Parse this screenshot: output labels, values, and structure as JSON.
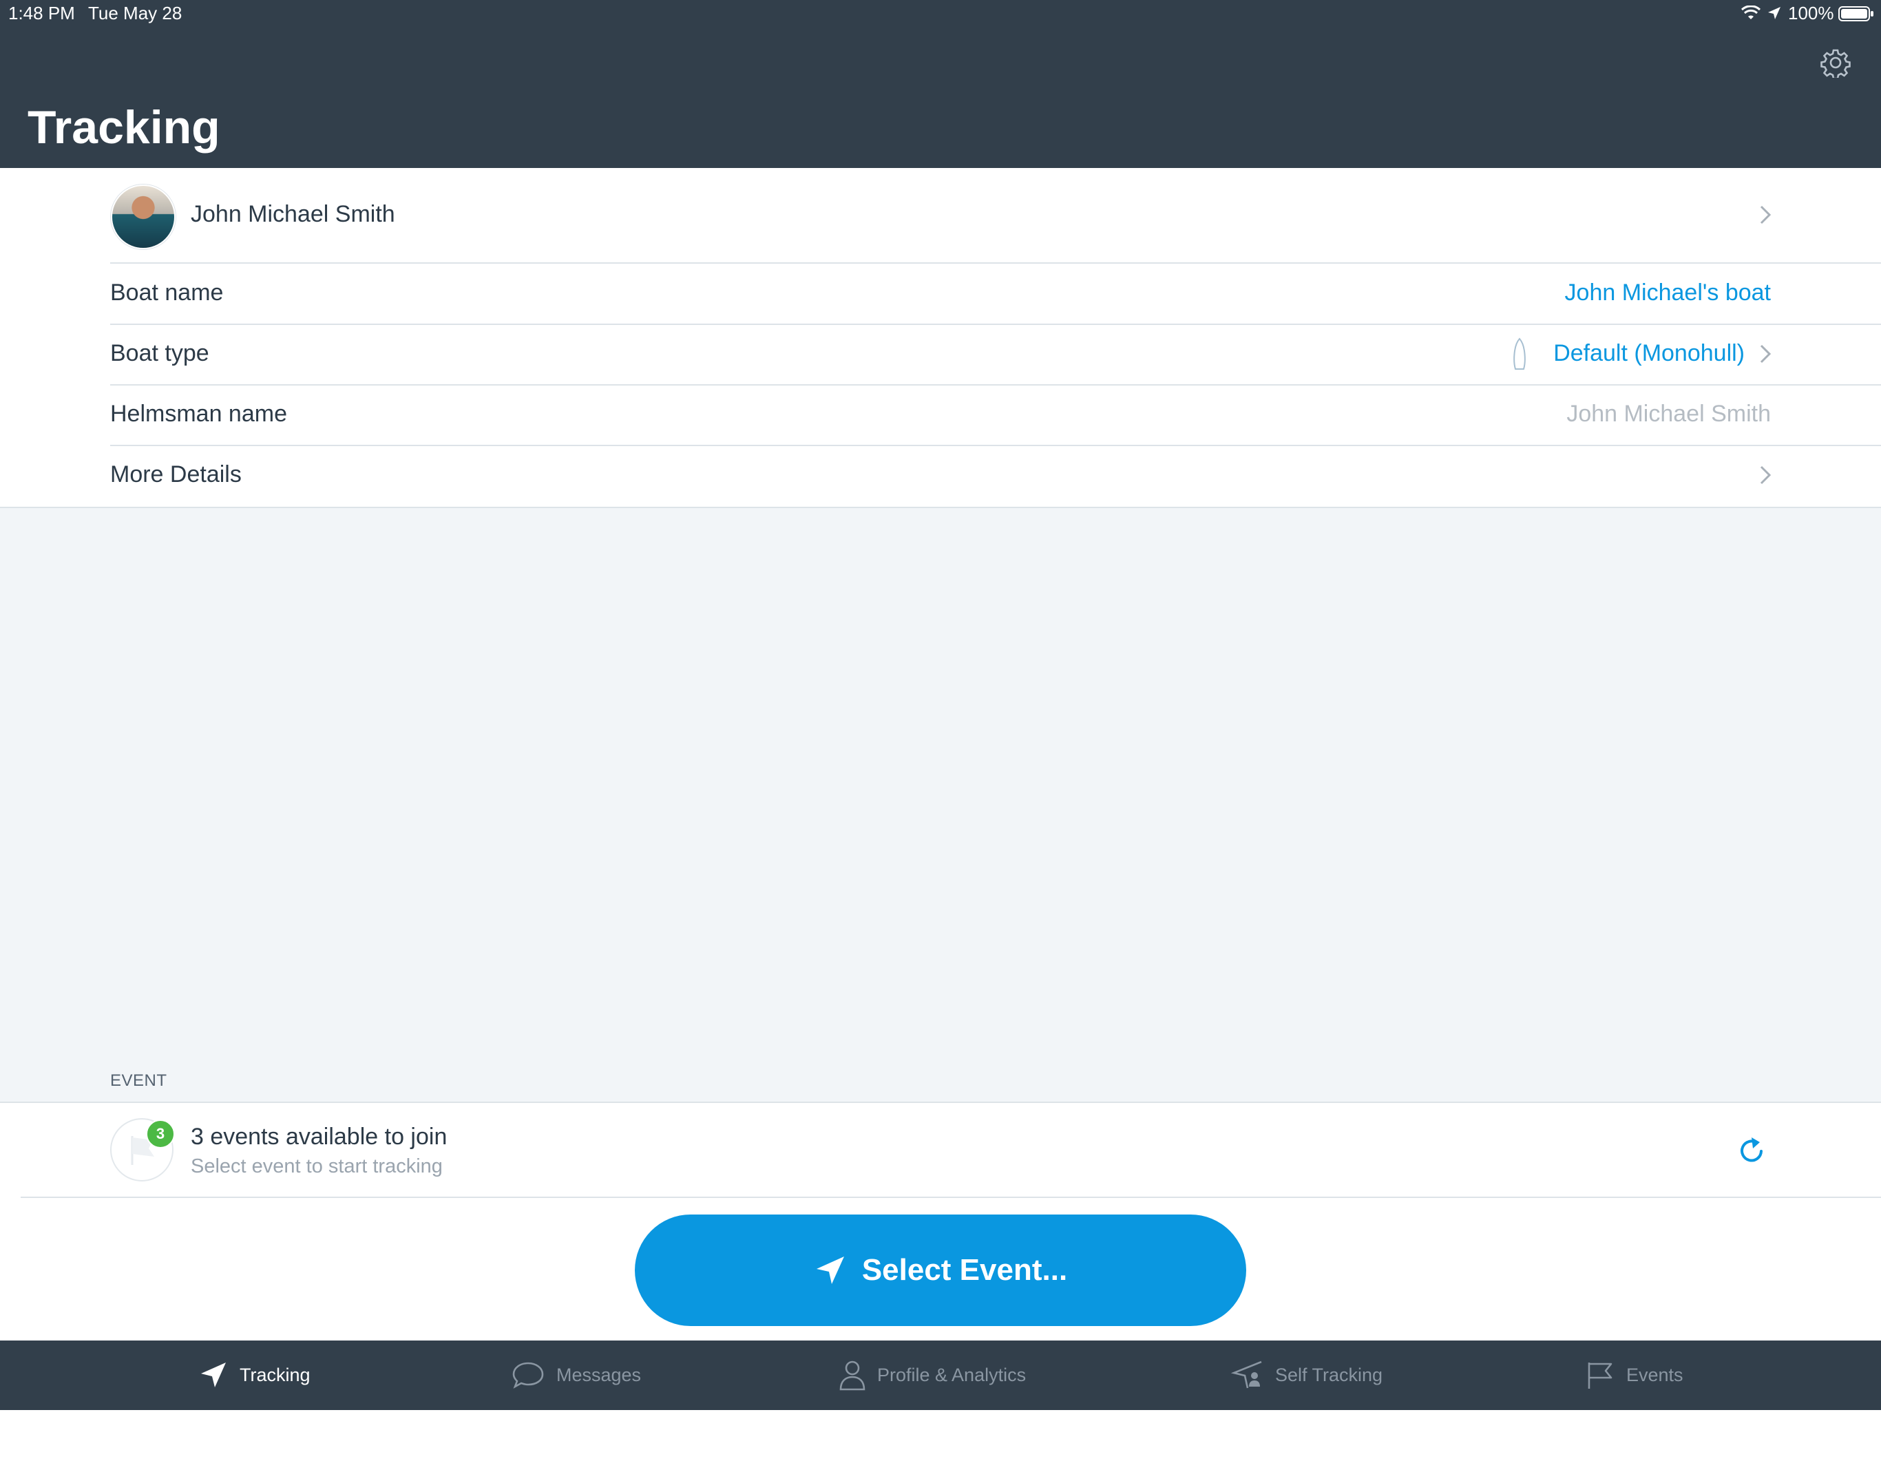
{
  "status_bar": {
    "time": "1:48 PM",
    "date": "Tue May 28",
    "battery": "100%"
  },
  "header": {
    "title": "Tracking"
  },
  "profile": {
    "name": "John Michael Smith"
  },
  "rows": [
    {
      "label": "Boat name",
      "value": "John Michael's boat"
    },
    {
      "label": "Boat type",
      "value": "Default (Monohull)"
    },
    {
      "label": "Helmsman name",
      "placeholder": "John Michael Smith"
    },
    {
      "label": "More Details"
    }
  ],
  "event_section": {
    "header": "EVENT",
    "badge_count": "3",
    "title": "3 events available to join",
    "subtitle": "Select event to start tracking"
  },
  "select_button": {
    "label": "Select Event..."
  },
  "tabs": [
    {
      "label": "Tracking",
      "icon": "navigation-arrow-icon",
      "active": true
    },
    {
      "label": "Messages",
      "icon": "chat-bubble-icon",
      "active": false
    },
    {
      "label": "Profile & Analytics",
      "icon": "person-icon",
      "active": false
    },
    {
      "label": "Self Tracking",
      "icon": "self-tracking-icon",
      "active": false
    },
    {
      "label": "Events",
      "icon": "flag-icon",
      "active": false
    }
  ],
  "colors": {
    "header_bg": "#323f4b",
    "accent": "#0a97e0",
    "badge_green": "#4cb944"
  }
}
